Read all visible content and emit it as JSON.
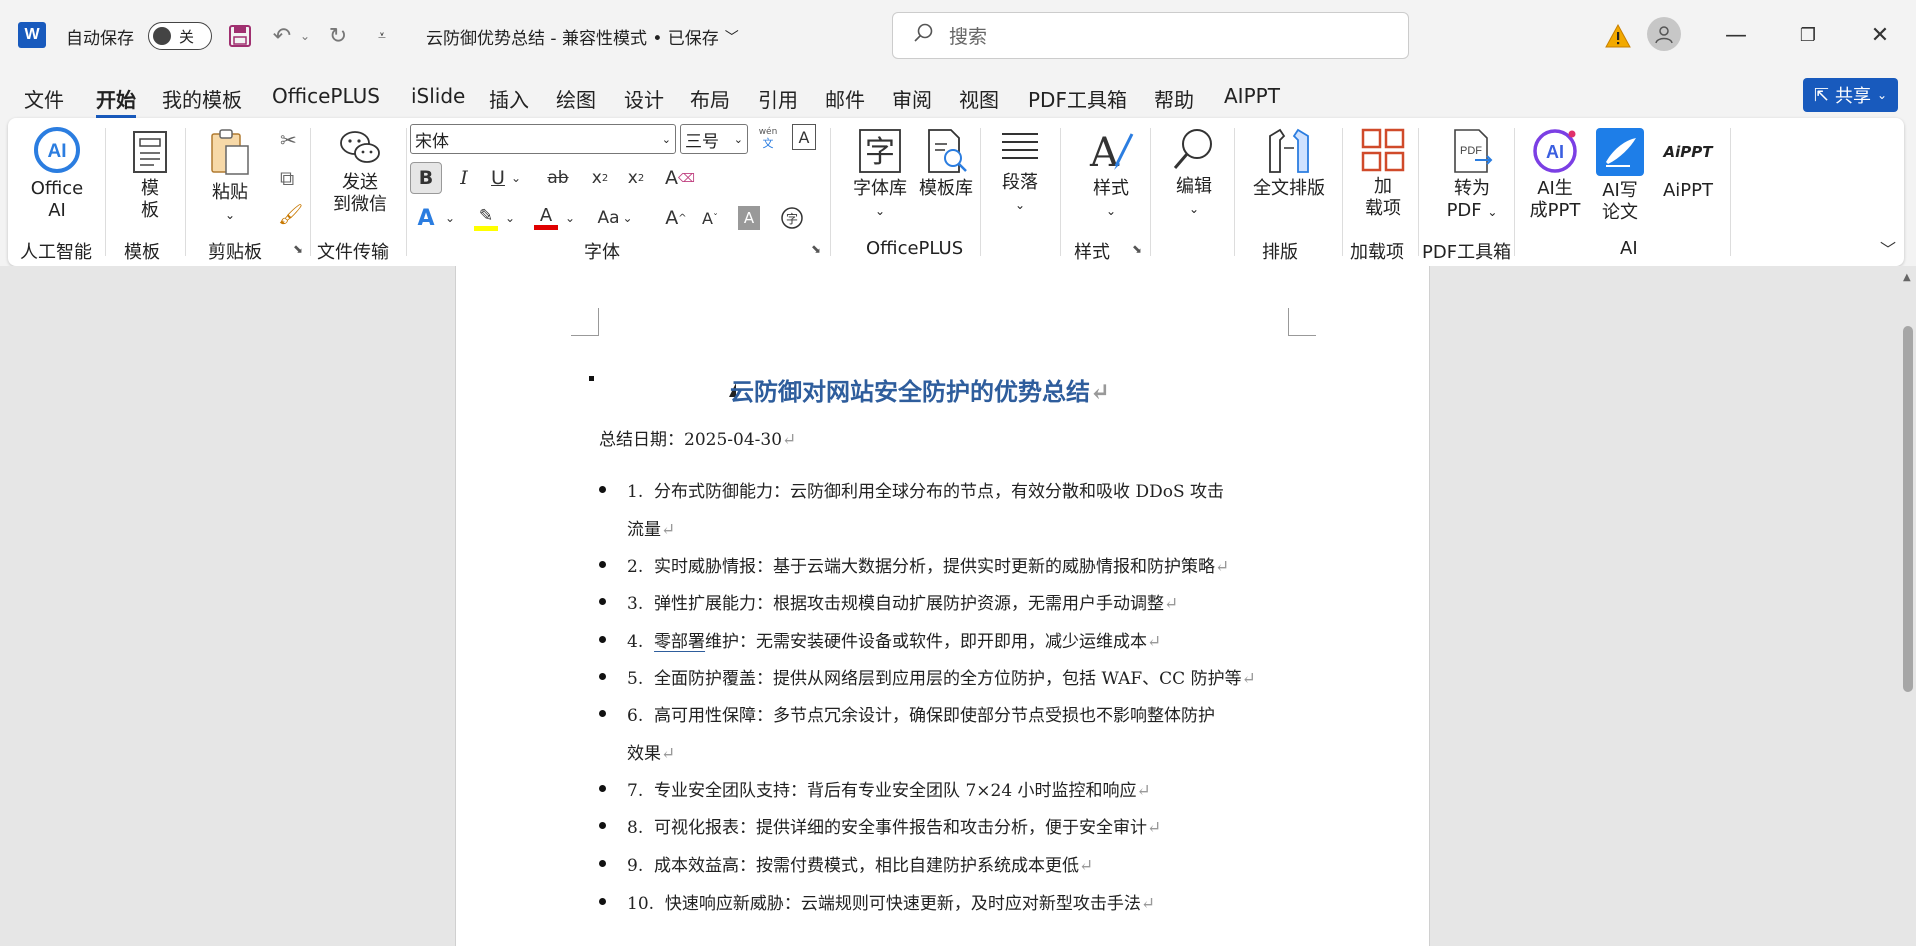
{
  "titlebar": {
    "autosave_label": "自动保存",
    "toggle_state": "关",
    "doc_title": "云防御优势总结  -  兼容性模式 • 已保存",
    "search_placeholder": "搜索"
  },
  "menubar": {
    "items": [
      "文件",
      "开始",
      "我的模板",
      "OfficePLUS",
      "iSlide",
      "插入",
      "绘图",
      "设计",
      "布局",
      "引用",
      "邮件",
      "审阅",
      "视图",
      "PDF工具箱",
      "帮助",
      "AIPPT"
    ],
    "active": "开始",
    "share_label": "共享"
  },
  "ribbon": {
    "office_ai": {
      "line1": "Office",
      "line2": "AI",
      "group": "人工智能"
    },
    "template": {
      "line1": "模",
      "line2": "板",
      "group": "模板"
    },
    "paste": {
      "label": "粘贴",
      "group": "剪贴板"
    },
    "send_wechat": {
      "line1": "发送",
      "line2": "到微信",
      "group": "文件传输"
    },
    "font": {
      "name": "宋体",
      "size": "三号",
      "phonetic": "wén",
      "phonetic_char": "文",
      "group": "字体",
      "change_case": "Aa"
    },
    "font_lib": "字体库",
    "template_lib": "模板库",
    "officeplus_group": "OfficePLUS",
    "paragraph": "段落",
    "styles": {
      "label": "样式",
      "group": "样式"
    },
    "editing": "编辑",
    "full_layout": {
      "label": "全文排版",
      "group": "排版"
    },
    "addins": {
      "line1": "加",
      "line2": "载项",
      "group": "加载项"
    },
    "to_pdf": {
      "line1": "转为",
      "line2": "PDF",
      "group": "PDF工具箱"
    },
    "ai_ppt_gen": {
      "line1": "AI生",
      "line2": "成PPT"
    },
    "ai_paper": {
      "line1": "AI写",
      "line2": "论文"
    },
    "aippt": {
      "label": "AiPPT",
      "logo_text": "AiPPT"
    },
    "ai_group": "AI",
    "colors": {
      "highlight": "#ffff00",
      "font_color": "#e00000"
    }
  },
  "document": {
    "heading": "云防御对网站安全防护的优势总结",
    "date_line": "总结日期：2025-04-30",
    "items": [
      {
        "num": "1.",
        "text": "分布式防御能力：云防御利用全球分布的节点，有效分散和吸收 DDoS 攻击",
        "cont": "流量"
      },
      {
        "num": "2.",
        "text": "实时威胁情报：基于云端大数据分析，提供实时更新的威胁情报和防护策略"
      },
      {
        "num": "3.",
        "text": "弹性扩展能力：根据攻击规模自动扩展防护资源，无需用户手动调整"
      },
      {
        "num": "4.",
        "underlined": "零部署",
        "text": "维护：无需安装硬件设备或软件，即开即用，减少运维成本"
      },
      {
        "num": "5.",
        "text": "全面防护覆盖：提供从网络层到应用层的全方位防护，包括 WAF、CC 防护等"
      },
      {
        "num": "6.",
        "text": "高可用性保障：多节点冗余设计，确保即使部分节点受损也不影响整体防护",
        "cont": "效果"
      },
      {
        "num": "7.",
        "text": "专业安全团队支持：背后有专业安全团队 7×24 小时监控和响应"
      },
      {
        "num": "8.",
        "text": "可视化报表：提供详细的安全事件报告和攻击分析，便于安全审计"
      },
      {
        "num": "9.",
        "text": "成本效益高：按需付费模式，相比自建防护系统成本更低"
      },
      {
        "num": "10.",
        "text": "快速响应新威胁：云端规则可快速更新，及时应对新型攻击手法"
      }
    ],
    "para_mark": "↵"
  }
}
